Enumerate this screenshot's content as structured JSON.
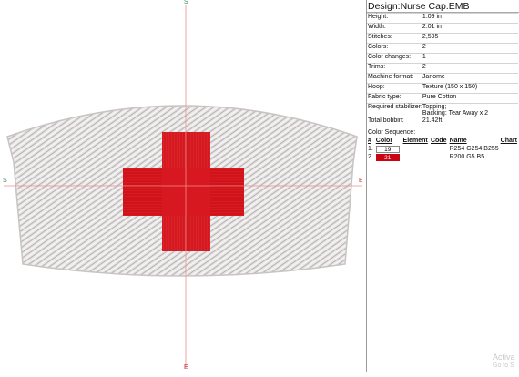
{
  "design_title": "Design:Nurse Cap.EMB",
  "properties": [
    {
      "label": "Height:",
      "value": "1.09 in"
    },
    {
      "label": "Width:",
      "value": "2.01 in"
    },
    {
      "label": "Stitches:",
      "value": "2,595"
    },
    {
      "label": "Colors:",
      "value": "2"
    },
    {
      "label": "Color changes:",
      "value": "1"
    },
    {
      "label": "Trims:",
      "value": "2"
    },
    {
      "label": "Machine format:",
      "value": "Janome"
    },
    {
      "label": "Hoop:",
      "value": "Texture (150 x 150)"
    },
    {
      "label": "Fabric type:",
      "value": "Pure Cotton"
    },
    {
      "label": "Required stabilizer:",
      "value": "Topping;",
      "value2": "Backing: Tear Away x 2"
    },
    {
      "label": "Total bobbin:",
      "value": "21.42ft"
    }
  ],
  "color_sequence": {
    "title": "Color Sequence:",
    "headers": [
      "#",
      "Color",
      "Element",
      "Code",
      "Name",
      "Chart"
    ],
    "rows": [
      {
        "num": "1.",
        "color": "19",
        "swatch": "#ffffff",
        "text_color": "#000000",
        "element": "",
        "code": "",
        "name": "R254 G254 B255",
        "chart": ""
      },
      {
        "num": "2.",
        "color": "21",
        "swatch": "#c80512",
        "text_color": "#ffffff",
        "element": "",
        "code": "",
        "name": "R200 G5 B5",
        "chart": ""
      }
    ]
  },
  "axes": {
    "top": "S",
    "bottom": "E",
    "left": "S",
    "right": "E"
  },
  "watermark": {
    "line1": "Activa",
    "line2": "Go to S"
  },
  "colors": {
    "cap_fill": "#e6e3e3",
    "cross_red": "#d4141c",
    "axis_line": "#f08c8c",
    "axis_green": "#2e8b57"
  }
}
